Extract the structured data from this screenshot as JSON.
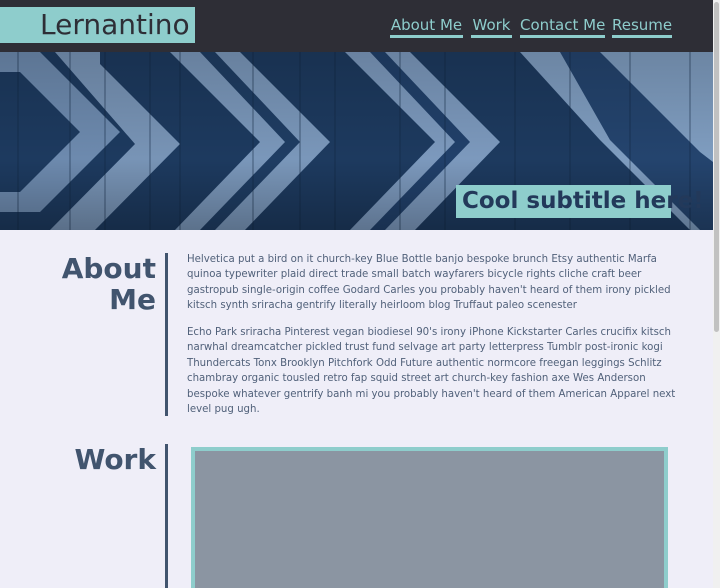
{
  "header": {
    "logo_text": "Lernantino",
    "nav": [
      "About Me",
      "Work",
      "Contact Me",
      "Resume"
    ]
  },
  "hero": {
    "subtitle": "Cool subtitle here!"
  },
  "about": {
    "heading": "About Me",
    "paragraphs": [
      "Helvetica put a bird on it church-key Blue Bottle banjo bespoke brunch Etsy authentic Marfa quinoa typewriter plaid direct trade small batch wayfarers bicycle rights cliche craft beer gastropub single-origin coffee Godard Carles you probably haven't heard of them irony pickled kitsch synth sriracha gentrify literally heirloom blog Truffaut paleo scenester",
      "Echo Park sriracha Pinterest vegan biodiesel 90's irony iPhone Kickstarter Carles crucifix kitsch narwhal dreamcatcher pickled trust fund selvage art party letterpress Tumblr post-ironic kogi Thundercats Tonx Brooklyn Pitchfork Odd Future authentic normcore freegan leggings Schlitz chambray organic tousled retro fap squid street art church-key fashion axe Wes Anderson bespoke whatever gentrify banh mi you probably haven't heard of them American Apparel next level pug ugh."
    ]
  },
  "work": {
    "heading": "Work"
  },
  "colors": {
    "accent": "#8ecdcc",
    "header_bg": "#2e2e36",
    "heading": "#41546e",
    "body_bg": "#efeef8"
  }
}
